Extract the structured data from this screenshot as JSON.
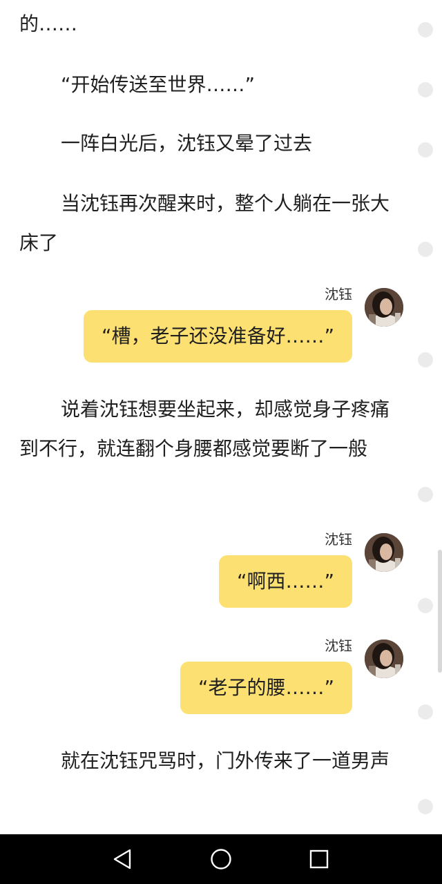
{
  "story": {
    "p1": "的……",
    "p2": "“开始传送至世界……”",
    "p3": "一阵白光后，沈钰又晕了过去",
    "p4": "当沈钰再次醒来时，整个人躺在一张大床了",
    "p5": "说着沈钰想要坐起来，却感觉身子疼痛到不行，就连翻个身腰都感觉要断了一般",
    "p6": "就在沈钰咒骂时，门外传来了一道男声"
  },
  "dialogue": [
    {
      "speaker": "沈钰",
      "text": "“槽，老子还没准备好……”"
    },
    {
      "speaker": "沈钰",
      "text": "“啊西……”"
    },
    {
      "speaker": "沈钰",
      "text": "“老子的腰……”"
    }
  ],
  "navigation": {
    "back_icon": "triangle-back-icon",
    "home_icon": "circle-home-icon",
    "recents_icon": "square-recents-icon"
  },
  "colors": {
    "bubble": "#fde072",
    "text": "#1f1f1f",
    "navbar": "#000000"
  }
}
